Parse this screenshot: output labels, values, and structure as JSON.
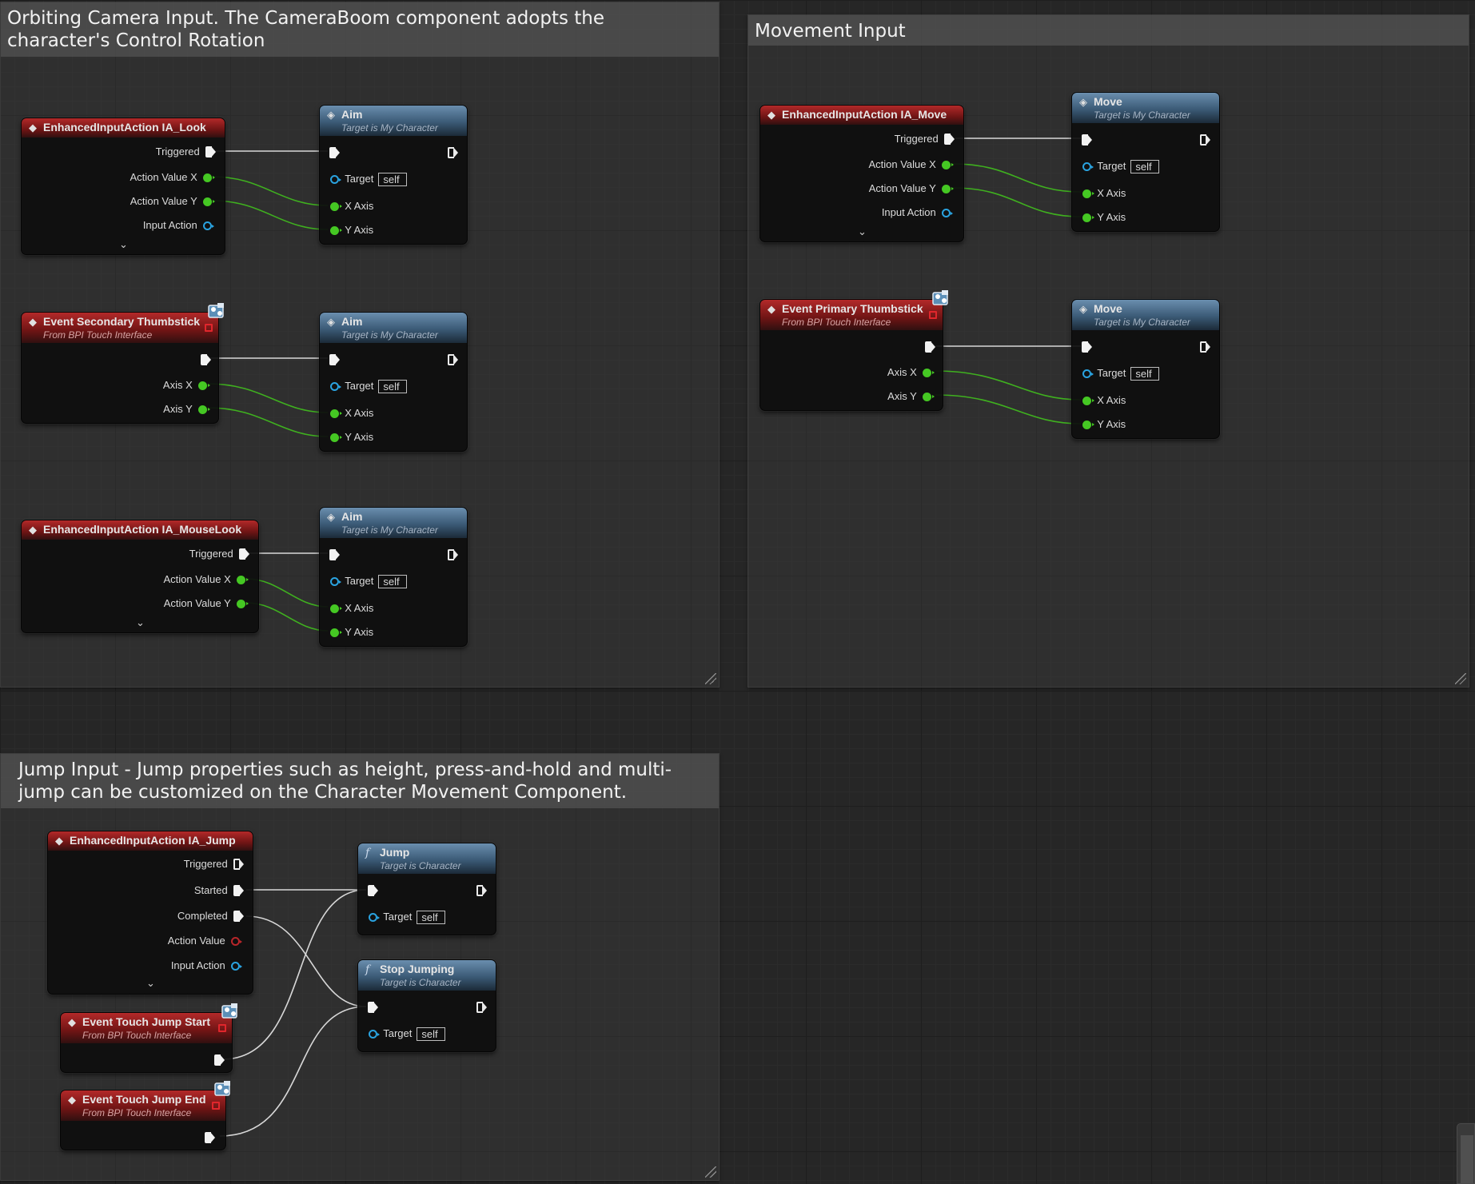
{
  "comments": {
    "orbit": "Orbiting Camera Input. The CameraBoom component adopts the character's Control Rotation",
    "movement": "Movement Input",
    "jump": "Jump Input - Jump properties such as height, press-and-hold and multi-jump can be customized on the Character Movement Component."
  },
  "icons": {
    "event": "event-diamond-icon",
    "function": "function-f-icon",
    "interface": "interface-icon",
    "expand": "chevron-down-icon"
  },
  "colors": {
    "event_header": "#b32929",
    "function_header": "#3b5a76",
    "exec_pin": "#f2f2f2",
    "float_pin": "#45c823",
    "object_pin": "#2aa3e0",
    "struct_pin": "#b8262a",
    "wire_float": "#45c823",
    "wire_exec": "#e8e8e8"
  },
  "nodes": {
    "ia_look": {
      "title": "EnhancedInputAction IA_Look",
      "pins": [
        "Triggered",
        "Action Value X",
        "Action Value Y",
        "Input Action"
      ]
    },
    "aim1": {
      "title": "Aim",
      "subtitle": "Target is My Character",
      "target": "Target",
      "self": "self",
      "x": "X Axis",
      "y": "Y Axis"
    },
    "secondary_thumb": {
      "title": "Event Secondary Thumbstick",
      "subtitle": "From BPI Touch Interface",
      "pins": [
        "Axis X",
        "Axis Y"
      ]
    },
    "aim2": {
      "title": "Aim",
      "subtitle": "Target is My Character",
      "target": "Target",
      "self": "self",
      "x": "X Axis",
      "y": "Y Axis"
    },
    "ia_mouselook": {
      "title": "EnhancedInputAction IA_MouseLook",
      "pins": [
        "Triggered",
        "Action Value X",
        "Action Value Y"
      ]
    },
    "aim3": {
      "title": "Aim",
      "subtitle": "Target is My Character",
      "target": "Target",
      "self": "self",
      "x": "X Axis",
      "y": "Y Axis"
    },
    "ia_move": {
      "title": "EnhancedInputAction IA_Move",
      "pins": [
        "Triggered",
        "Action Value X",
        "Action Value Y",
        "Input Action"
      ]
    },
    "move1": {
      "title": "Move",
      "subtitle": "Target is My Character",
      "target": "Target",
      "self": "self",
      "x": "X Axis",
      "y": "Y Axis"
    },
    "primary_thumb": {
      "title": "Event Primary Thumbstick",
      "subtitle": "From BPI Touch Interface",
      "pins": [
        "Axis X",
        "Axis Y"
      ]
    },
    "move2": {
      "title": "Move",
      "subtitle": "Target is My Character",
      "target": "Target",
      "self": "self",
      "x": "X Axis",
      "y": "Y Axis"
    },
    "ia_jump": {
      "title": "EnhancedInputAction IA_Jump",
      "pins": [
        "Triggered",
        "Started",
        "Completed",
        "Action Value",
        "Input Action"
      ]
    },
    "touch_jump_start": {
      "title": "Event Touch Jump Start",
      "subtitle": "From BPI Touch Interface"
    },
    "touch_jump_end": {
      "title": "Event Touch Jump End",
      "subtitle": "From BPI Touch Interface"
    },
    "jump": {
      "title": "Jump",
      "subtitle": "Target is Character",
      "target": "Target",
      "self": "self"
    },
    "stop_jumping": {
      "title": "Stop Jumping",
      "subtitle": "Target is Character",
      "target": "Target",
      "self": "self"
    }
  }
}
